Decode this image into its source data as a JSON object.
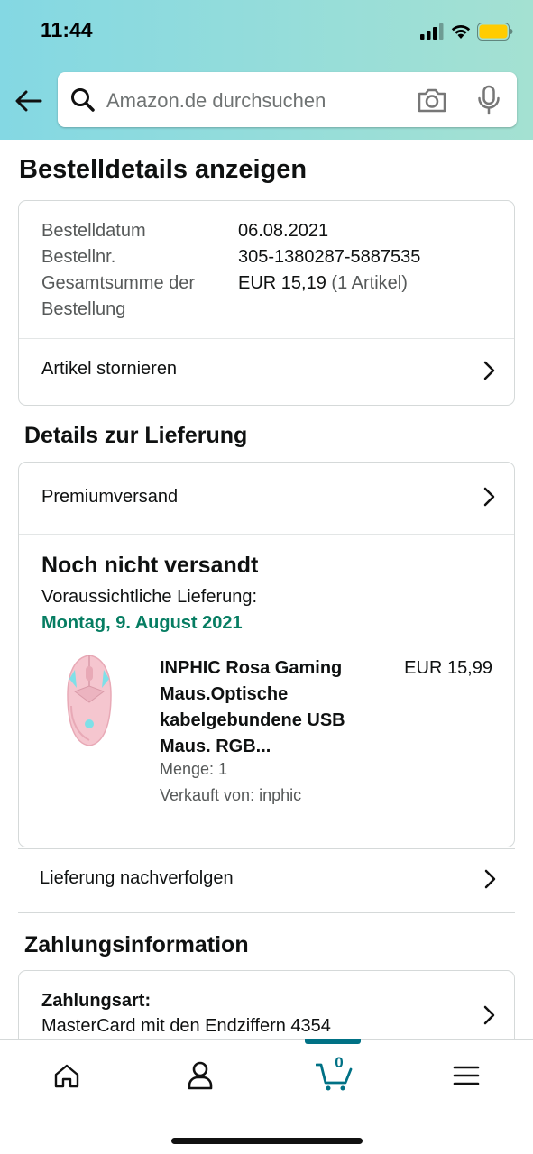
{
  "status_bar": {
    "time": "11:44"
  },
  "search": {
    "placeholder": "Amazon.de durchsuchen"
  },
  "page_title": "Bestelldetails anzeigen",
  "order_info": {
    "rows": [
      {
        "label": "Bestelldatum",
        "value": "06.08.2021"
      },
      {
        "label": "Bestellnr.",
        "value": "305-1380287-5887535"
      },
      {
        "label_line1": "Gesamtsumme der",
        "label_line2": "Bestellung",
        "value": "EUR 15,19",
        "value_note": "(1 Artikel)"
      }
    ],
    "cancel_label": "Artikel stornieren"
  },
  "delivery": {
    "section_title": "Details zur Lieferung",
    "shipping_method": "Premiumversand",
    "status": "Noch nicht versandt",
    "eta_label": "Voraussichtliche Lieferung:",
    "eta_date": "Montag, 9. August 2021",
    "product": {
      "title": "INPHIC Rosa Gaming Maus.Optische kabelgebundene USB Maus. RGB...",
      "price": "EUR 15,99",
      "quantity": "Menge: 1",
      "seller": "Verkauft von: inphic"
    },
    "track_label": "Lieferung nachverfolgen"
  },
  "payment": {
    "section_title": "Zahlungsinformation",
    "label": "Zahlungsart:",
    "value": "MasterCard mit den Endziffern 4354"
  },
  "bottom_nav": {
    "cart_count": "0",
    "items": [
      "home-icon",
      "account-icon",
      "cart-icon",
      "menu-icon"
    ]
  },
  "colors": {
    "accent": "#007185",
    "delivery_green": "#067d62",
    "header_from": "#84d8e3",
    "header_to": "#a4e1d2"
  }
}
